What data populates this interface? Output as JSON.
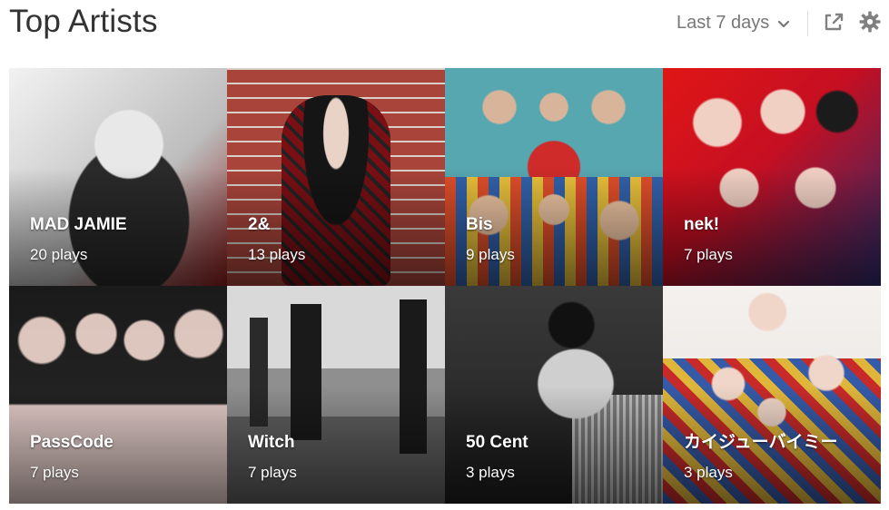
{
  "header": {
    "title": "Top Artists",
    "period_label": "Last 7 days",
    "share_icon": "share-external-icon",
    "settings_icon": "gear-icon"
  },
  "artists": [
    {
      "name": "MAD JAMIE",
      "plays": "20 plays"
    },
    {
      "name": "2&",
      "plays": "13 plays"
    },
    {
      "name": "Bis",
      "plays": "9 plays"
    },
    {
      "name": "nek!",
      "plays": "7 plays"
    },
    {
      "name": "PassCode",
      "plays": "7 plays"
    },
    {
      "name": "Witch",
      "plays": "7 plays"
    },
    {
      "name": "50 Cent",
      "plays": "3 plays"
    },
    {
      "name": "カイジューバイミー",
      "plays": "3 plays"
    }
  ],
  "colors": {
    "title": "#333333",
    "muted": "#777777",
    "overlay_text": "#ffffff"
  }
}
